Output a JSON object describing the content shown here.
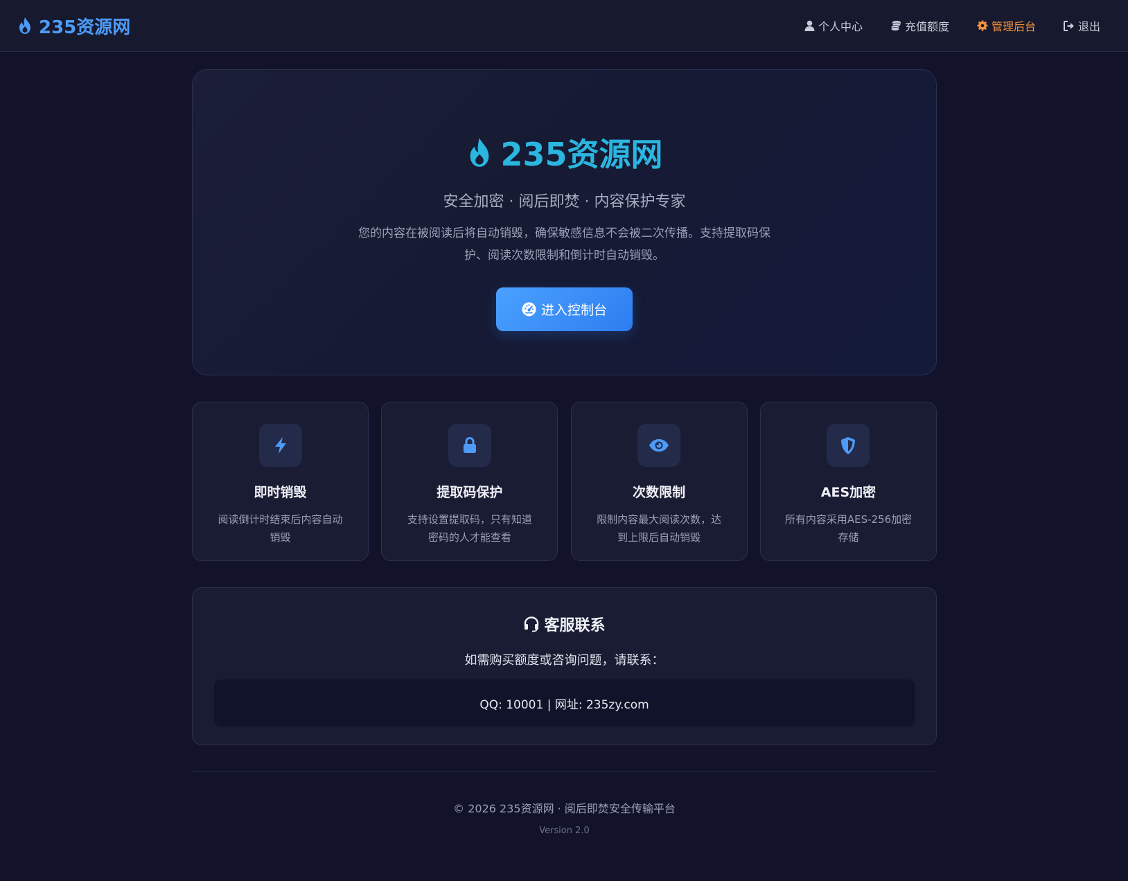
{
  "nav": {
    "brand": "235资源网",
    "links": [
      {
        "label": "个人中心",
        "icon": "user-icon"
      },
      {
        "label": "充值额度",
        "icon": "coins-icon"
      },
      {
        "label": "管理后台",
        "icon": "gear-icon"
      },
      {
        "label": "退出",
        "icon": "logout-icon"
      }
    ],
    "active_color": "#f5913a",
    "brand_color": "#4d9bf7"
  },
  "hero": {
    "title": "235资源网",
    "subtitle": "安全加密 · 阅后即焚 · 内容保护专家",
    "description": "您的内容在被阅读后将自动销毁，确保敏感信息不会被二次传播。支持提取码保护、阅读次数限制和倒计时自动销毁。",
    "cta_label": "进入控制台",
    "title_color": "#2bb6e0"
  },
  "features": [
    {
      "icon": "bolt-icon",
      "title": "即时销毁",
      "desc": "阅读倒计时结束后内容自动销毁"
    },
    {
      "icon": "lock-icon",
      "title": "提取码保护",
      "desc": "支持设置提取码，只有知道密码的人才能查看"
    },
    {
      "icon": "eye-icon",
      "title": "次数限制",
      "desc": "限制内容最大阅读次数，达到上限后自动销毁"
    },
    {
      "icon": "shield-icon",
      "title": "AES加密",
      "desc": "所有内容采用AES-256加密存储"
    }
  ],
  "support": {
    "title": "客服联系",
    "text": "如需购买额度或咨询问题，请联系：",
    "contact": "QQ: 10001 | 网址: 235zy.com"
  },
  "footer": {
    "copyright": "© 2026 235资源网 · 阅后即焚安全传输平台",
    "version": "Version 2.0"
  }
}
